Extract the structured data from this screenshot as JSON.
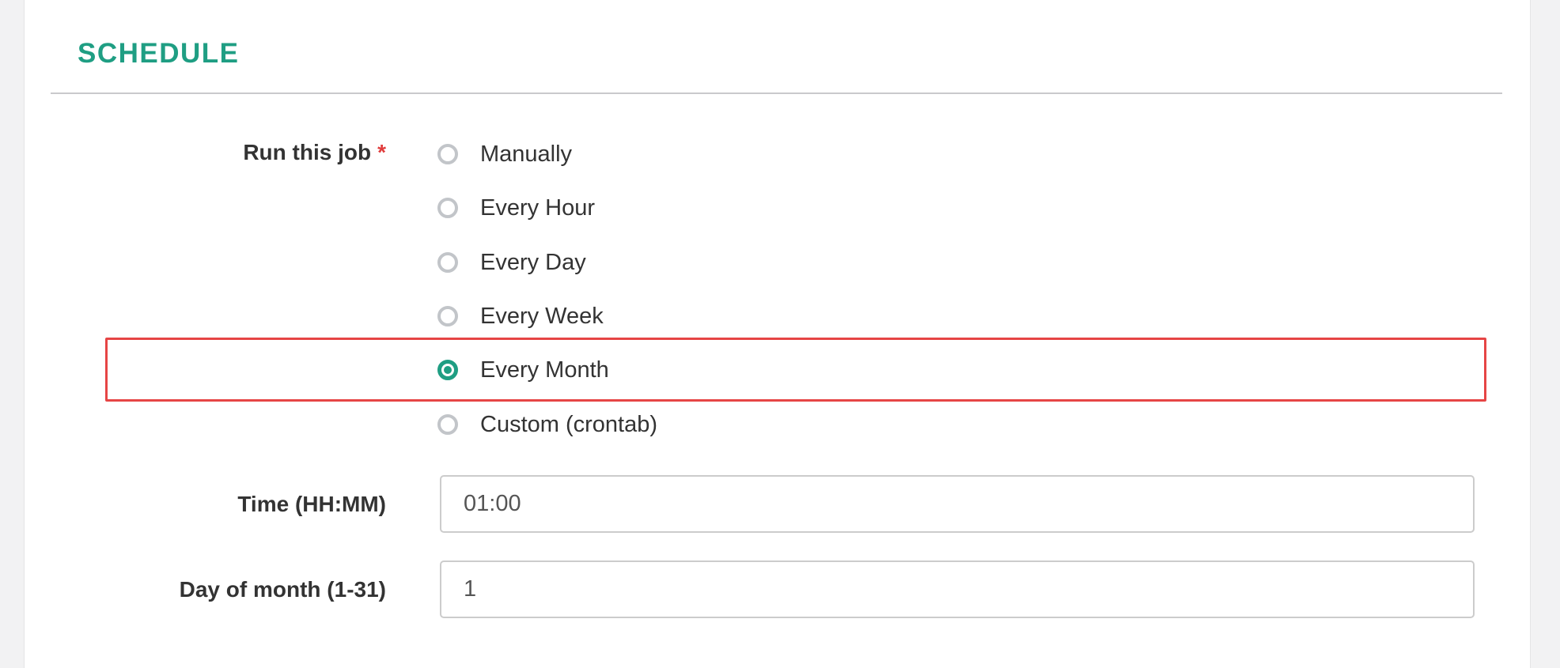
{
  "colors": {
    "accent": "#1f9e83",
    "required": "#e03c3c",
    "highlight": "#e64545"
  },
  "section": {
    "title": "SCHEDULE"
  },
  "run_job": {
    "label": "Run this job",
    "required_marker": "*",
    "selected": "Every Month",
    "options": [
      {
        "label": "Manually",
        "checked": false
      },
      {
        "label": "Every Hour",
        "checked": false
      },
      {
        "label": "Every Day",
        "checked": false
      },
      {
        "label": "Every Week",
        "checked": false
      },
      {
        "label": "Every Month",
        "checked": true
      },
      {
        "label": "Custom (crontab)",
        "checked": false
      }
    ]
  },
  "time_field": {
    "label": "Time (HH:MM)",
    "value": "01:00"
  },
  "day_field": {
    "label": "Day of month (1-31)",
    "value": "1"
  }
}
